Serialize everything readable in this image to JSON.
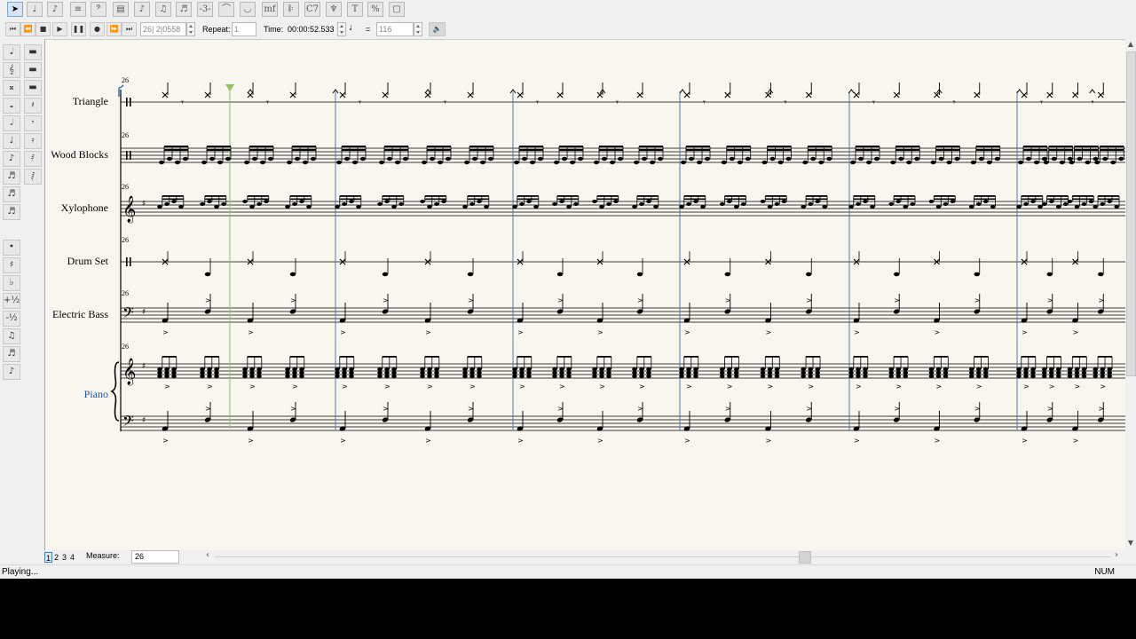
{
  "toolbar": {
    "tools": [
      {
        "name": "select-arrow-icon",
        "glyph": "➤",
        "active": true
      },
      {
        "name": "note-tool-icon",
        "glyph": "♩"
      },
      {
        "name": "grace-note-icon",
        "glyph": "♪"
      },
      {
        "name": "chord-tool-icon",
        "glyph": "≡"
      },
      {
        "name": "clef-tool-icon",
        "glyph": "𝄢"
      },
      {
        "name": "staff-tool-icon",
        "glyph": "▤"
      },
      {
        "name": "eighth-note-icon",
        "glyph": "♪"
      },
      {
        "name": "beam-tool-icon",
        "glyph": "♫"
      },
      {
        "name": "tuplet-tool-icon",
        "glyph": "♬"
      },
      {
        "name": "triplet-tool-icon",
        "glyph": "-3-"
      },
      {
        "name": "slur-tool-icon",
        "glyph": "⌒"
      },
      {
        "name": "tie-tool-icon",
        "glyph": "◡"
      },
      {
        "name": "dynamics-tool-icon",
        "glyph": "mf"
      },
      {
        "name": "repeat-tool-icon",
        "glyph": "𝄆"
      },
      {
        "name": "chord-symbol-icon",
        "glyph": "C7"
      },
      {
        "name": "ornament-tool-icon",
        "glyph": "♆"
      },
      {
        "name": "text-tool-icon",
        "glyph": "T"
      },
      {
        "name": "percent-tool-icon",
        "glyph": "%"
      },
      {
        "name": "page-tool-icon",
        "glyph": "▢"
      }
    ]
  },
  "transport": {
    "position": "26| 2|0558",
    "repeat_label": "Repeat:",
    "repeat_value": "1",
    "time_label": "Time:",
    "time_value": "00:00:52.533",
    "tempo_equals": "=",
    "tempo_value": "116"
  },
  "score": {
    "measure_number": "26",
    "staves": [
      {
        "name": "Triangle",
        "kind": "perc1"
      },
      {
        "name": "Wood Blocks",
        "kind": "perc5"
      },
      {
        "name": "Xylophone",
        "kind": "treble"
      },
      {
        "name": "Drum Set",
        "kind": "perc1"
      },
      {
        "name": "Electric Bass",
        "kind": "bass"
      },
      {
        "name": "Piano",
        "kind": "grand"
      }
    ]
  },
  "bottombar": {
    "pages": [
      "1",
      "2",
      "3",
      "4"
    ],
    "active_page": 0,
    "measure_label": "Measure:",
    "measure_value": "26"
  },
  "status": {
    "left": "Playing...",
    "right": "NUM"
  },
  "colors": {
    "paper": "#f8f6ee",
    "playhead": "#8fc25a",
    "piano_label": "#2455a6",
    "barline_blue": "#3e6fb0"
  }
}
